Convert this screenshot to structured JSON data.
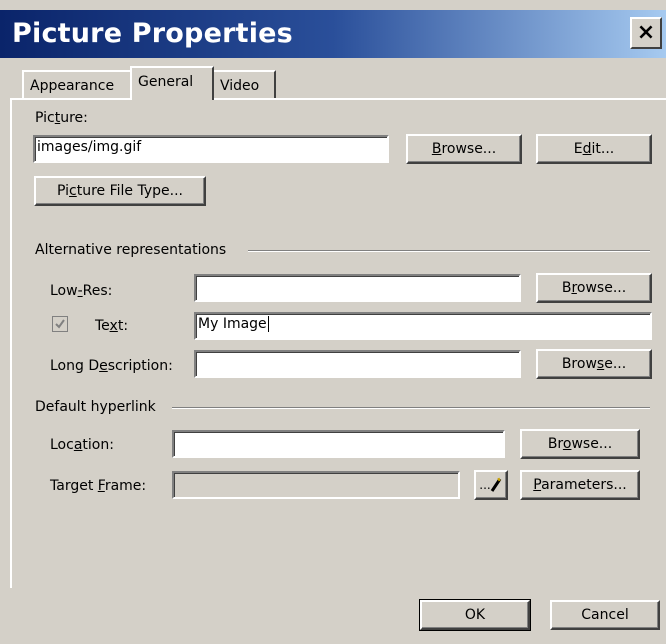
{
  "window": {
    "title": "Picture Properties",
    "close_glyph": "×"
  },
  "tabs": [
    {
      "label": "Appearance",
      "active": false
    },
    {
      "label": "General",
      "active": true
    },
    {
      "label": "Video",
      "active": false
    }
  ],
  "picture": {
    "label_pre": "Pic",
    "label_u": "t",
    "label_post": "ure:",
    "value": "images/img.gif",
    "browse_u": "B",
    "browse_post": "rowse...",
    "edit_pre": "E",
    "edit_u": "d",
    "edit_post": "it...",
    "filetype_pre": "Pi",
    "filetype_u": "c",
    "filetype_post": "ture File Type..."
  },
  "alt": {
    "heading": "Alternative representations",
    "lowres_pre": "Low",
    "lowres_u": "-",
    "lowres_post": "Res:",
    "lowres_value": "",
    "lowres_browse_pre": "B",
    "lowres_browse_u": "r",
    "lowres_browse_post": "owse...",
    "text_checked": true,
    "text_pre": "Te",
    "text_u": "x",
    "text_post": "t:",
    "text_value": "My Image",
    "longdesc_pre": "Long D",
    "longdesc_u": "e",
    "longdesc_post": "scription:",
    "longdesc_value": "",
    "longdesc_browse_pre": "Brow",
    "longdesc_browse_u": "s",
    "longdesc_browse_post": "e..."
  },
  "hyperlink": {
    "heading": "Default hyperlink",
    "location_pre": "Loc",
    "location_u": "a",
    "location_post": "tion:",
    "location_value": "",
    "location_browse_pre": "Br",
    "location_browse_u": "o",
    "location_browse_post": "wse...",
    "target_pre": "Target ",
    "target_u": "F",
    "target_post": "rame:",
    "target_value": "",
    "target_btn_label": "...",
    "parameters_u": "P",
    "parameters_post": "arameters..."
  },
  "footer": {
    "ok": "OK",
    "cancel": "Cancel"
  }
}
